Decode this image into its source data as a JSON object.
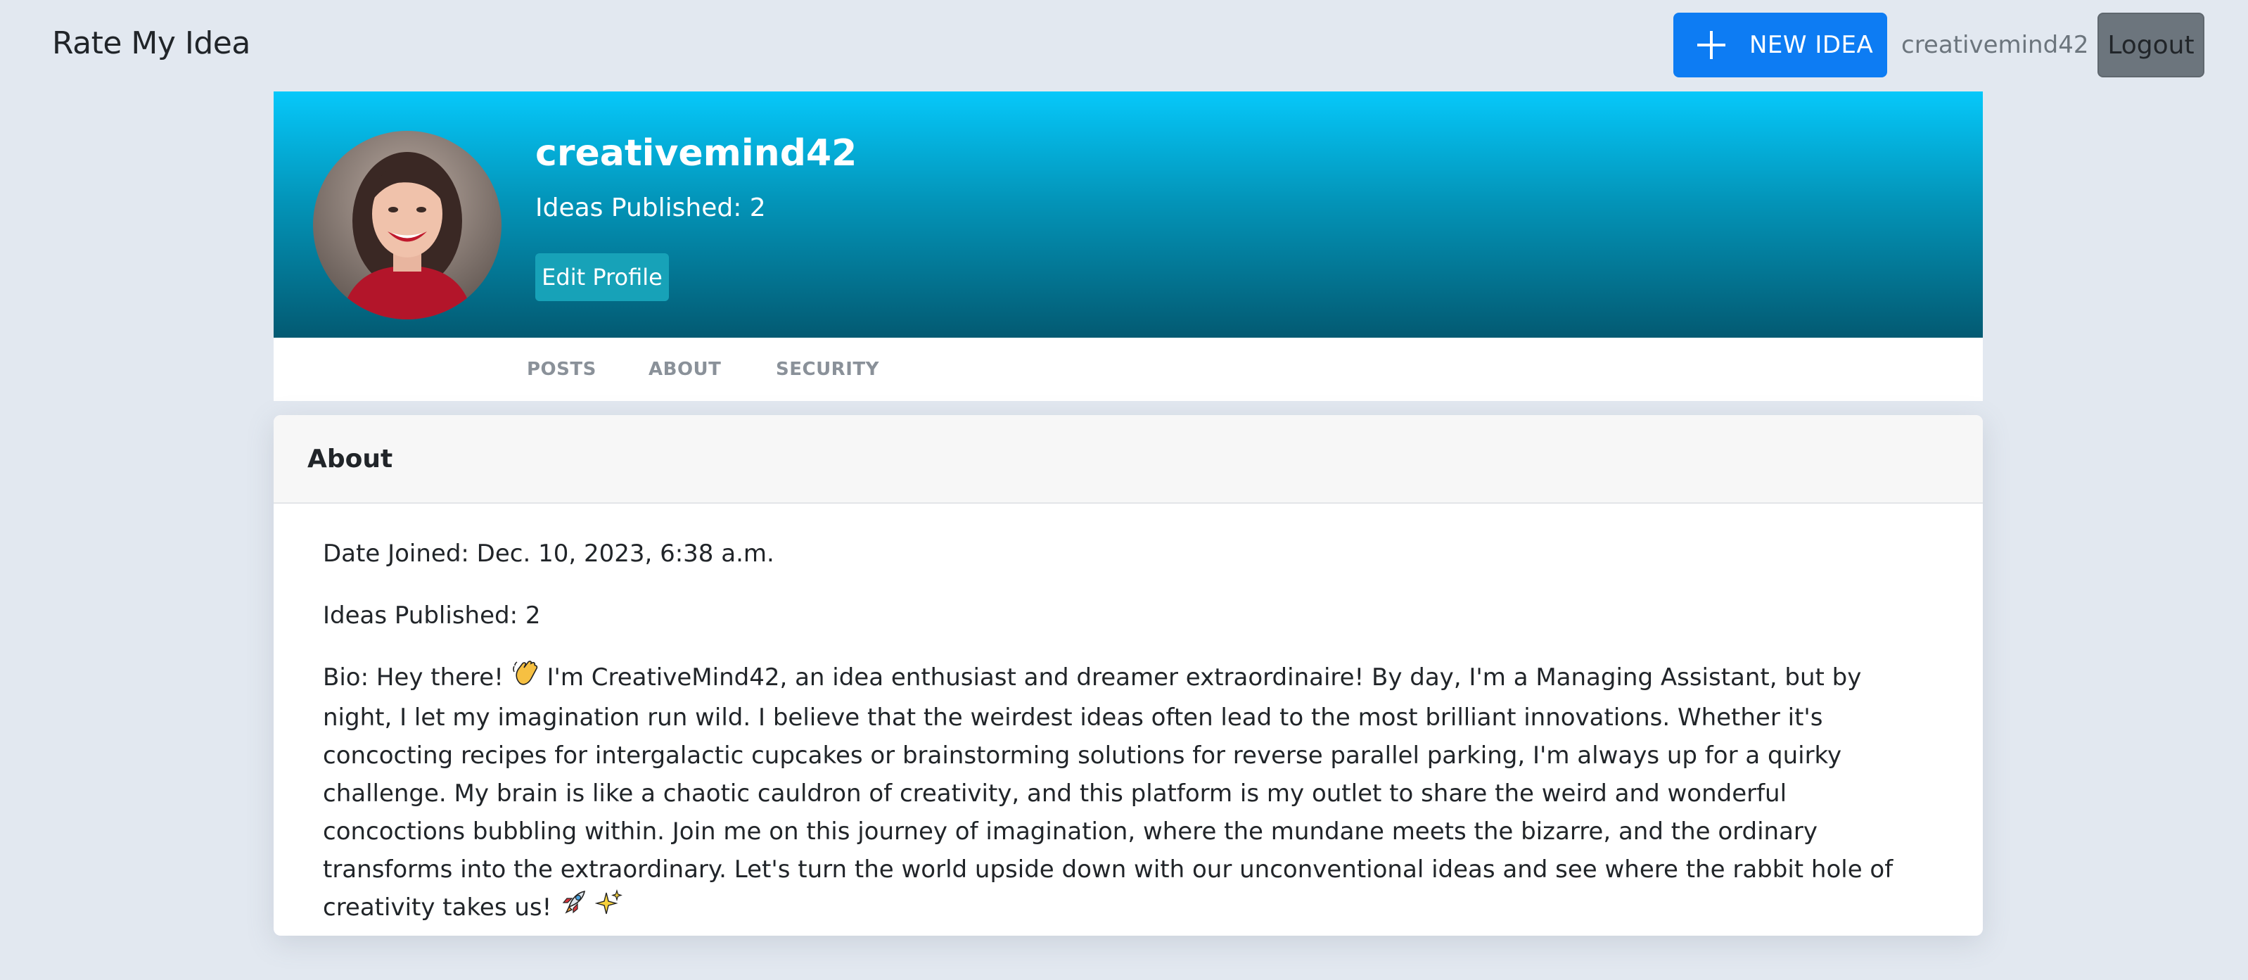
{
  "navbar": {
    "brand": "Rate My Idea",
    "new_idea_label": "NEW IDEA",
    "username": "creativemind42",
    "logout_label": "Logout"
  },
  "profile": {
    "username": "creativemind42",
    "ideas_published": "Ideas Published: 2",
    "edit_profile_label": "Edit Profile"
  },
  "tabs": [
    {
      "label": "POSTS"
    },
    {
      "label": "ABOUT"
    },
    {
      "label": "SECURITY"
    }
  ],
  "about": {
    "title": "About",
    "date_joined": "Date Joined: Dec. 10, 2023, 6:38 a.m.",
    "ideas_published": "Ideas Published: 2",
    "bio_prefix": "Bio: Hey there!",
    "bio_text": "I'm CreativeMind42, an idea enthusiast and dreamer extraordinaire! By day, I'm a Managing Assistant, but by night, I let my imagination run wild. I believe that the weirdest ideas often lead to the most brilliant innovations. Whether it's concocting recipes for intergalactic cupcakes or brainstorming solutions for reverse parallel parking, I'm always up for a quirky challenge. My brain is like a chaotic cauldron of creativity, and this platform is my outlet to share the weird and wonderful concoctions bubbling within. Join me on this journey of imagination, where the mundane meets the bizarre, and the ordinary transforms into the extraordinary. Let's turn the world upside down with our unconventional ideas and see where the rabbit hole of creativity takes us!"
  },
  "colors": {
    "primary": "#0d7cf3",
    "secondary": "#6c757d",
    "info": "#17a2b8",
    "header_gradient_top": "#06c8fa",
    "header_gradient_bottom": "#035a72",
    "page_background": "#e2e8f0"
  },
  "icons": [
    "plus-icon",
    "waving-hand-icon",
    "rocket-icon",
    "sparkles-icon"
  ]
}
